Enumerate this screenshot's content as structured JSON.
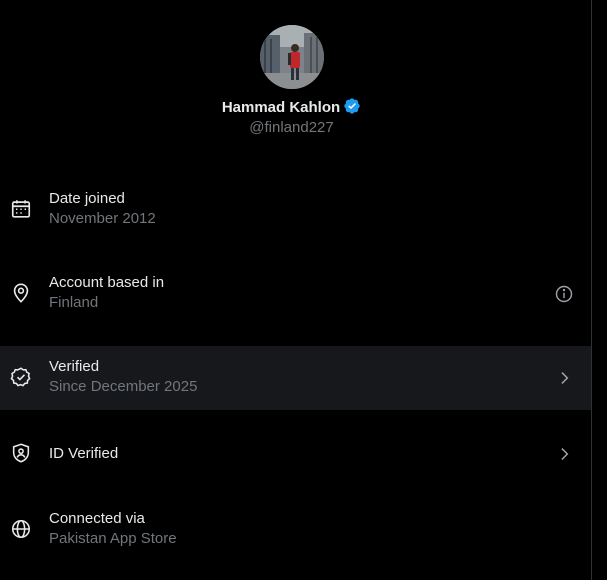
{
  "profile": {
    "name": "Hammad Kahlon",
    "handle": "@finland227"
  },
  "rows": [
    {
      "title": "Date joined",
      "subtitle": "November 2012",
      "icon": "calendar-icon"
    },
    {
      "title": "Account based in",
      "subtitle": "Finland",
      "icon": "location-pin-icon",
      "trailing": "info-icon"
    },
    {
      "title": "Verified",
      "subtitle": "Since December 2025",
      "icon": "verified-check-icon",
      "trailing": "chevron-right-icon"
    },
    {
      "title": "ID Verified",
      "icon": "id-shield-icon",
      "trailing": "chevron-right-icon"
    },
    {
      "title": "Connected via",
      "subtitle": "Pakistan App Store",
      "icon": "globe-icon"
    }
  ],
  "colors": {
    "background": "#000000",
    "primary_text": "#e7e9ea",
    "secondary_text": "#71767b",
    "highlight_row": "#16181c",
    "verified_badge": "#1d9bf0"
  }
}
